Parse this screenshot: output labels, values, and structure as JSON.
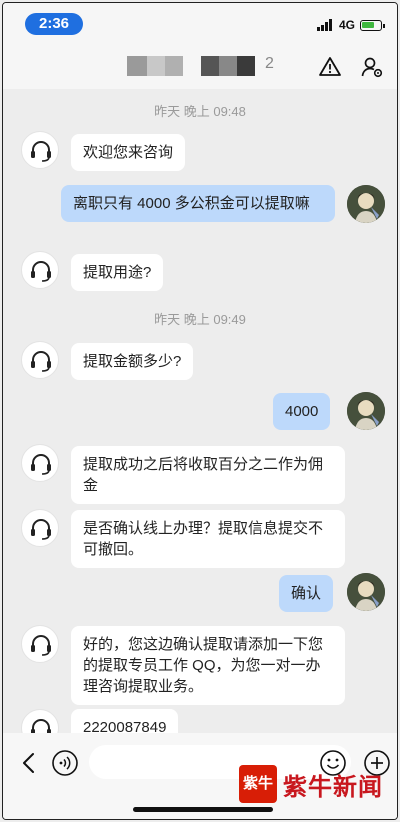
{
  "status_bar": {
    "time": "2:36",
    "network": "4G"
  },
  "header": {
    "title_suffix": "2"
  },
  "messages": {
    "ts1": "昨天 晚上 09:48",
    "m1": "欢迎您来咨询",
    "m2": "离职只有 4000 多公积金可以提取嘛",
    "m3": "提取用途?",
    "ts2": "昨天 晚上 09:49",
    "m4": "提取金额多少?",
    "m5": "4000",
    "m6": "提取成功之后将收取百分之二作为佣金",
    "m7": "是否确认线上办理？提取信息提交不可撤回。",
    "m8": "确认",
    "m9": "好的，您这边确认提取请添加一下您的提取专员工作 QQ，为您一对一办理咨询提取业务。",
    "m10": "2220087849"
  },
  "watermark": {
    "seal": "紫牛",
    "text": "紫牛新闻"
  },
  "colors": {
    "user_bubble": "#bdd9fb",
    "time_pill": "#1f6fe0",
    "watermark_red": "#c8171e"
  }
}
